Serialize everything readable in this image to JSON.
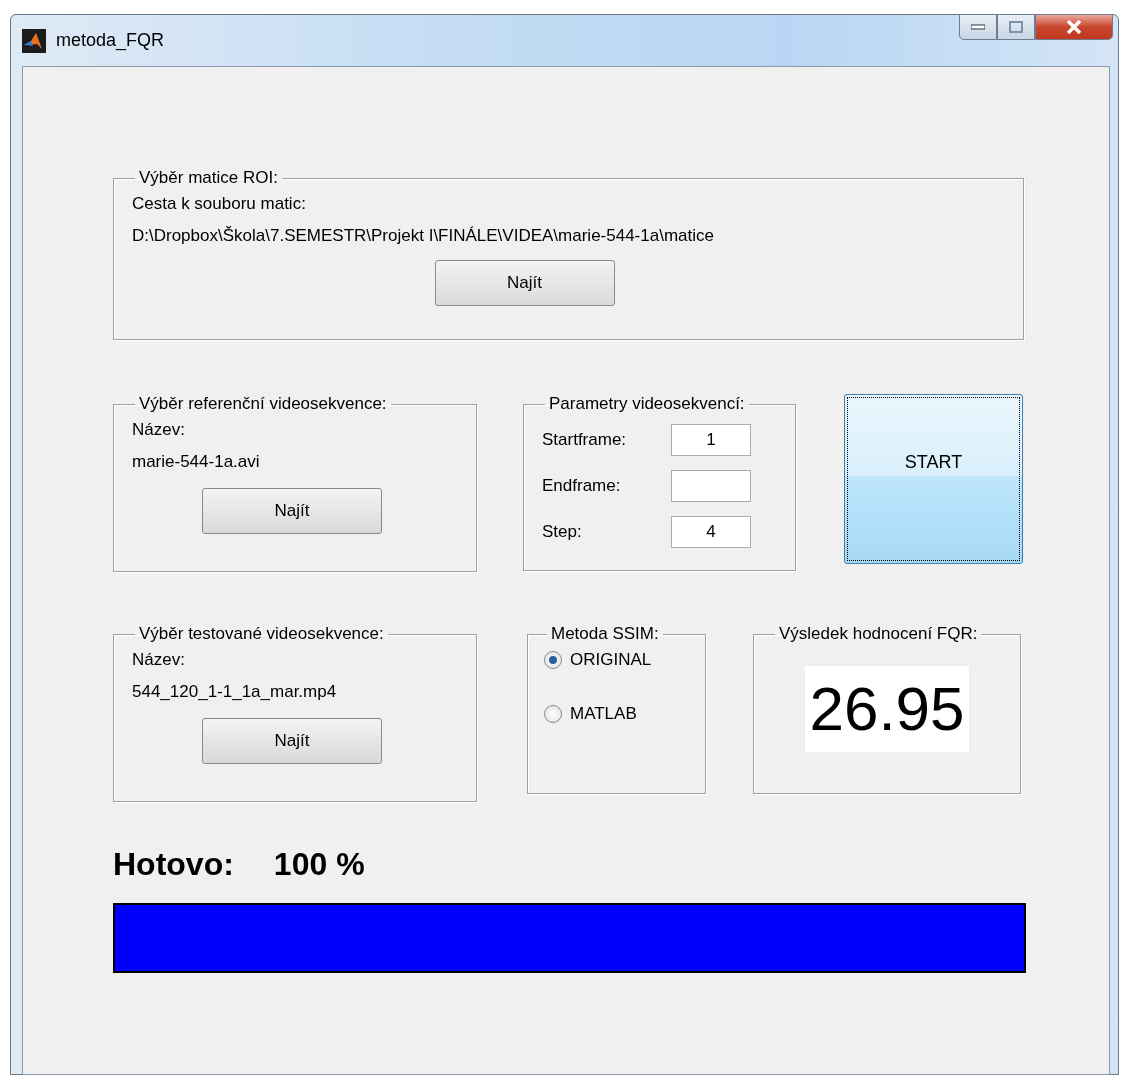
{
  "window": {
    "title": "metoda_FQR"
  },
  "roi_panel": {
    "title": "Výběr matice ROI:",
    "label": "Cesta k souboru matic:",
    "path": "D:\\Dropbox\\Škola\\7.SEMESTR\\Projekt I\\FINÁLE\\VIDEA\\marie-544-1a\\matice",
    "button": "Najít"
  },
  "reference_panel": {
    "title": "Výběr referenční videosekvence:",
    "label": "Název:",
    "file": "marie-544-1a.avi",
    "button": "Najít"
  },
  "parameters_panel": {
    "title": "Parametry videosekvencí:",
    "fields": [
      {
        "label": "Startframe:",
        "value": "1"
      },
      {
        "label": "Endframe:"
      },
      {
        "label": "Step:",
        "value": "4"
      }
    ]
  },
  "start_button": "START",
  "test_panel": {
    "title": "Výběr testované videosekvence:",
    "label": "Název:",
    "file": "544_120_1-1_1a_mar.mp4",
    "button": "Najít"
  },
  "ssim_panel": {
    "title": "Metoda SSIM:",
    "options": [
      {
        "label": "ORIGINAL",
        "selected": true
      },
      {
        "label": "MATLAB",
        "selected": false
      }
    ]
  },
  "result_panel": {
    "title": "Výsledek hodnocení FQR:",
    "value": "26.95"
  },
  "progress": {
    "label": "Hotovo:",
    "percent": "100 %",
    "level": 1
  }
}
